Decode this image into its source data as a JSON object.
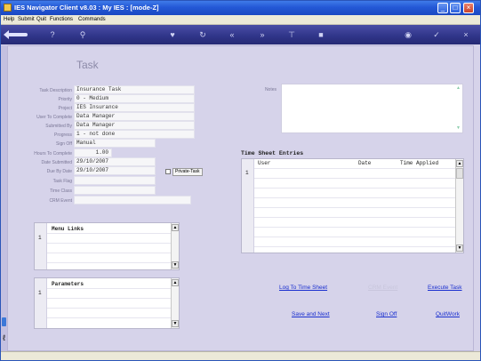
{
  "window": {
    "title": "IES Navigator Client v8.03 : My IES :      [mode-Z]"
  },
  "menubar": {
    "items": [
      "Help",
      "Submit",
      "Quit",
      "Functions",
      "Commands"
    ]
  },
  "toolbar": {
    "icons": [
      "back-arrow-icon",
      "help-icon",
      "search-icon",
      "heart-icon",
      "refresh-icon",
      "double-left-icon",
      "double-right-icon",
      "tree-icon",
      "stop-icon",
      "globe-icon",
      "check-icon",
      "close-icon"
    ]
  },
  "page": {
    "title": "Task"
  },
  "fields": [
    {
      "label": "Task Description",
      "value": "Insurance Task"
    },
    {
      "label": "Priority",
      "value": "0 - Medium"
    },
    {
      "label": "Project",
      "value": "IES Insurance"
    },
    {
      "label": "User To Complete",
      "value": "Data Manager"
    },
    {
      "label": "Submitted By",
      "value": "Data Manager"
    },
    {
      "label": "Progress",
      "value": "1 - not done"
    },
    {
      "label": "Sign Off",
      "value": "Manual"
    },
    {
      "label": "Hours To Complete",
      "value": "1.00"
    },
    {
      "label": "Date Submitted",
      "value": "29/10/2007"
    },
    {
      "label": "Due By Date",
      "value": "29/10/2007"
    },
    {
      "label": "Task Flag",
      "value": ""
    },
    {
      "label": "Time Class",
      "value": ""
    },
    {
      "label": "CRM Event",
      "value": ""
    }
  ],
  "private_task": {
    "label": "Private-Task",
    "checked": false
  },
  "notes": {
    "label": "Notes"
  },
  "timesheet": {
    "title": "Time Sheet Entries",
    "columns": [
      "User",
      "Date",
      "Time Applied"
    ],
    "row_numbers": [
      "1"
    ]
  },
  "menu_links": {
    "title": "Menu Links",
    "row_numbers": [
      "1"
    ]
  },
  "parameters": {
    "title": "Parameters",
    "row_numbers": [
      "1"
    ]
  },
  "actions": {
    "log_time": "Log To Time Sheet",
    "crm_event": "CRM Event",
    "execute": "Execute Task",
    "save_next": "Save and Next",
    "sign_off": "Sign Off",
    "quit_work": "QuitWork"
  },
  "colors": {
    "title_bar": "#2458d6",
    "toolbar": "#2f3488",
    "content_bg": "#d6d3ea",
    "link": "#1a2fcf"
  }
}
